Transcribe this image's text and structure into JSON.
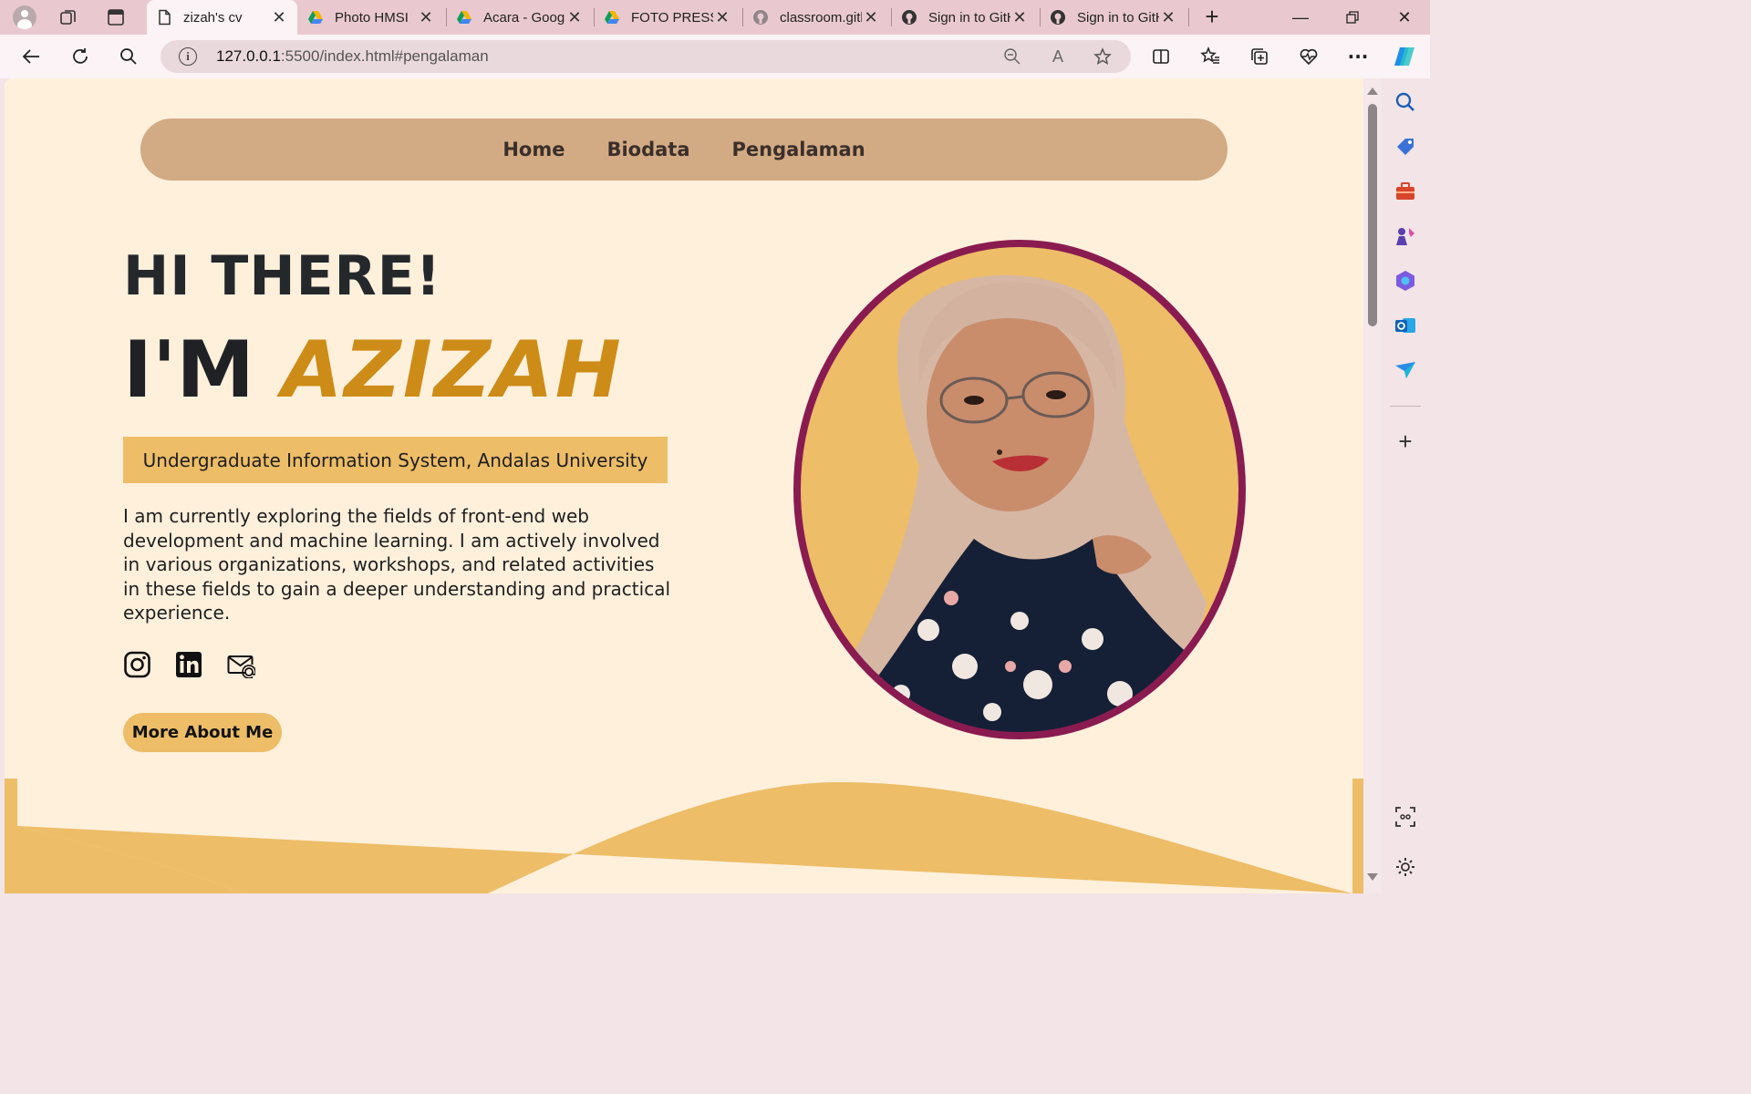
{
  "browser": {
    "tabs": [
      {
        "title": "zizah's cv",
        "icon": "document-icon"
      },
      {
        "title": "Photo HMSI",
        "icon": "google-drive-icon"
      },
      {
        "title": "Acara - Google Drive",
        "icon": "google-drive-icon"
      },
      {
        "title": "FOTO PRESS",
        "icon": "google-drive-icon"
      },
      {
        "title": "classroom.github",
        "icon": "github-icon"
      },
      {
        "title": "Sign in to GitHub",
        "icon": "github-icon"
      },
      {
        "title": "Sign in to GitHub",
        "icon": "github-icon"
      }
    ],
    "active_tab": 0,
    "url_host": "127.0.0.1",
    "url_rest": ":5500/index.html#pengalaman"
  },
  "site": {
    "nav": [
      "Home",
      "Biodata",
      "Pengalaman"
    ],
    "greeting": "HI THERE!",
    "im": "I'M",
    "name": "AZIZAH",
    "subtitle": "Undergraduate Information System, Andalas University",
    "bio": "I am currently exploring the fields of front-end web development and machine learning. I am actively involved in various organizations, workshops, and related activities in these fields to gain a deeper understanding and practical experience.",
    "socials": [
      "instagram-icon",
      "linkedin-icon",
      "email-icon"
    ],
    "cta": "More About Me",
    "colors": {
      "page_bg": "#fff0dc",
      "nav_bg": "#d2aa83",
      "accent_gold": "#edbd67",
      "name_gold": "#cd8c17",
      "portrait_ring": "#8a1b50"
    }
  }
}
